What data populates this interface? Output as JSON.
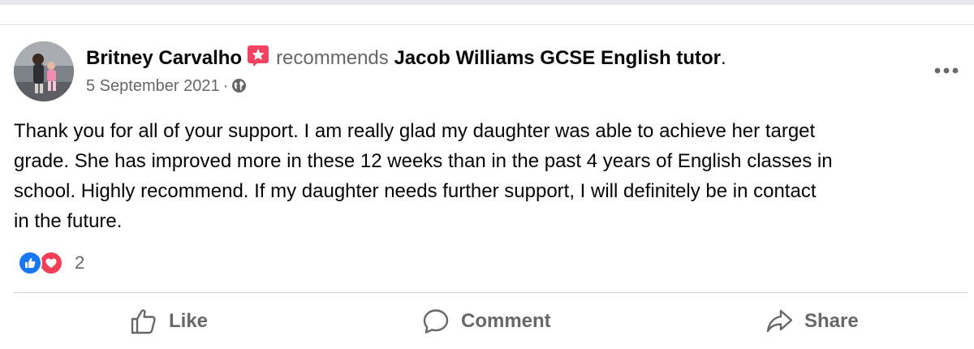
{
  "post": {
    "author": "Britney Carvalho",
    "action": "recommends",
    "page": "Jacob Williams GCSE English tutor",
    "trailing_dot": ".",
    "date": "5 September 2021",
    "separator": "·",
    "privacy_icon": "globe-icon",
    "more_icon": "more-options-icon",
    "text_lines": [
      "Thank you for all of your support. I am really glad my daughter was able to achieve her target",
      "grade. She has improved more in these 12 weeks than in the past 4 years of English classes in",
      "school. Highly recommend. If my daughter needs further support, I will definitely be in contact",
      "in the future."
    ]
  },
  "reactions": {
    "types": [
      "like",
      "love"
    ],
    "count": "2"
  },
  "actions": {
    "like_label": "Like",
    "comment_label": "Comment",
    "share_label": "Share"
  },
  "colors": {
    "secondary_text": "#65676b",
    "like_blue": "#1877f2",
    "love_red": "#f33e58",
    "badge_pink": "#f3425f"
  }
}
